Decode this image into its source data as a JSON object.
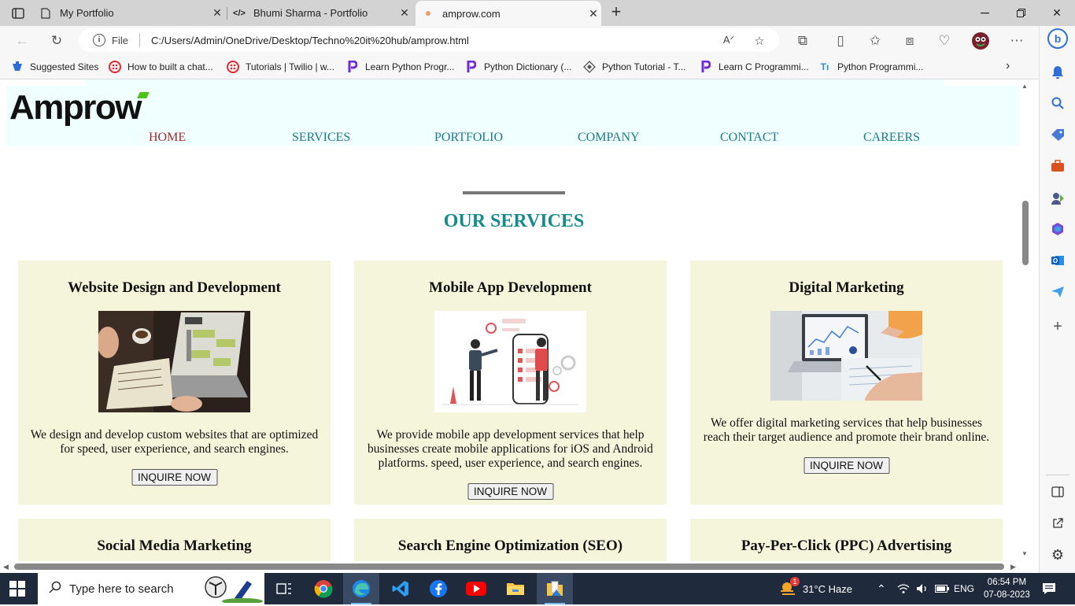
{
  "browser": {
    "tabs": [
      {
        "title": "My Portfolio",
        "icon": "page-icon",
        "active": false
      },
      {
        "title": "Bhumi Sharma - Portfolio",
        "icon": "code-icon",
        "active": false
      },
      {
        "title": "amprow.com",
        "icon": "globe-icon",
        "active": true
      }
    ],
    "address": {
      "scheme_label": "File",
      "url": "C:/Users/Admin/OneDrive/Desktop/Techno%20it%20hub/amprow.html"
    },
    "favorites": [
      {
        "label": "Suggested Sites",
        "icon": "edge-icon"
      },
      {
        "label": "How to built a chat...",
        "icon": "twilio-icon"
      },
      {
        "label": "Tutorials | Twilio | w...",
        "icon": "twilio-icon"
      },
      {
        "label": "Learn Python Progr...",
        "icon": "programiz-icon"
      },
      {
        "label": "Python Dictionary (...",
        "icon": "programiz-icon"
      },
      {
        "label": "Python Tutorial - T...",
        "icon": "diamond-icon"
      },
      {
        "label": "Learn C Programmi...",
        "icon": "programiz-icon"
      },
      {
        "label": "Python Programmi...",
        "icon": "tutorial-icon"
      }
    ]
  },
  "site": {
    "logo": "Amprow",
    "nav": [
      "HOME",
      "SERVICES",
      "PORTFOLIO",
      "COMPANY",
      "CONTACT",
      "CAREERS"
    ],
    "section_title": "OUR SERVICES",
    "cards": [
      {
        "title": "Website Design and Development",
        "desc": "We design and develop custom websites that are optimized for speed, user experience, and search engines.",
        "button": "INQUIRE NOW"
      },
      {
        "title": "Mobile App Development",
        "desc": "We provide mobile app development services that help businesses create mobile applications for iOS and Android platforms. speed, user experience, and search engines.",
        "button": "INQUIRE NOW"
      },
      {
        "title": "Digital Marketing",
        "desc": "We offer digital marketing services that help businesses reach their target audience and promote their brand online.",
        "button": "INQUIRE NOW"
      },
      {
        "title": "Social Media Marketing"
      },
      {
        "title": "Search Engine Optimization (SEO)"
      },
      {
        "title": "Pay-Per-Click (PPC) Advertising"
      }
    ]
  },
  "taskbar": {
    "search_placeholder": "Type here to search",
    "weather": "31°C  Haze",
    "weather_badge": "1",
    "language": "ENG",
    "time": "06:54 PM",
    "date": "07-08-2023"
  },
  "colors": {
    "header_bg": "#f0ffff",
    "nav_link": "#1d7a8a",
    "nav_active": "#a52a2a",
    "section_title": "#178a8a",
    "card_bg": "#f5f5dc",
    "logo_accent": "#4cc316"
  }
}
